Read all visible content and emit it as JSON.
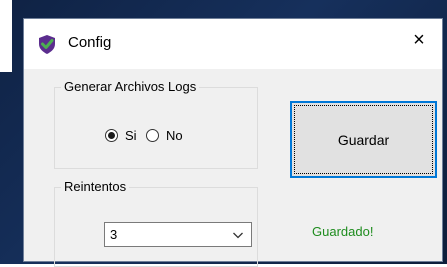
{
  "window": {
    "title": "Config",
    "close_glyph": "×",
    "icon": "checkmark-shield-icon"
  },
  "logs_group": {
    "label": "Generar Archivos Logs",
    "options": [
      {
        "label": "Si",
        "checked": true
      },
      {
        "label": "No",
        "checked": false
      }
    ]
  },
  "save_button": {
    "label": "Guardar"
  },
  "retries_group": {
    "label": "Reintentos",
    "selected": "3"
  },
  "status": {
    "text": "Guardado!",
    "color": "#1e8c1e"
  },
  "colors": {
    "accent": "#0078d7",
    "icon_purple": "#5b2d8e",
    "icon_green": "#4caf50"
  }
}
